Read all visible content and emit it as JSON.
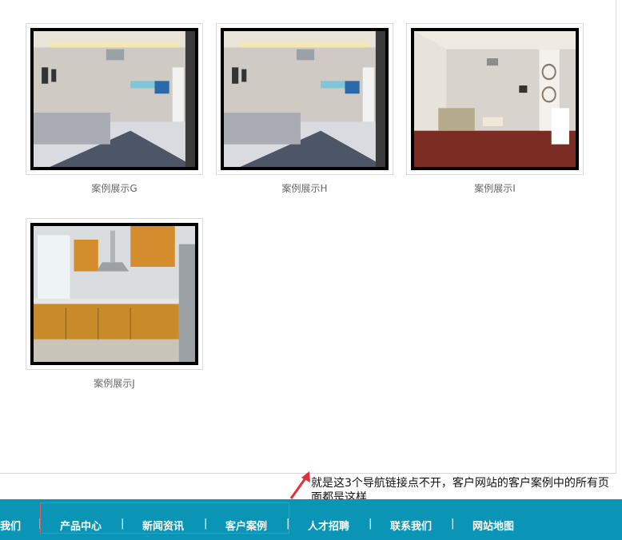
{
  "gallery": {
    "items": [
      {
        "caption": "案例展示G",
        "icon": "living-room-image"
      },
      {
        "caption": "案例展示H",
        "icon": "living-room-image"
      },
      {
        "caption": "案例展示I",
        "icon": "living-room-image"
      },
      {
        "caption": "案例展示J",
        "icon": "kitchen-image"
      }
    ]
  },
  "annotation": {
    "text": "就是这3个导航链接点不开，客户网站的客户案例中的所有页面都是这样."
  },
  "nav": {
    "items": [
      "我们",
      "产品中心",
      "新闻资讯",
      "客户案例",
      "人才招聘",
      "联系我们",
      "网站地图"
    ],
    "separator": "|"
  },
  "colors": {
    "nav_background": "#0a95b6",
    "highlight_border": "#e35b5b",
    "arrow": "#e0303a"
  }
}
